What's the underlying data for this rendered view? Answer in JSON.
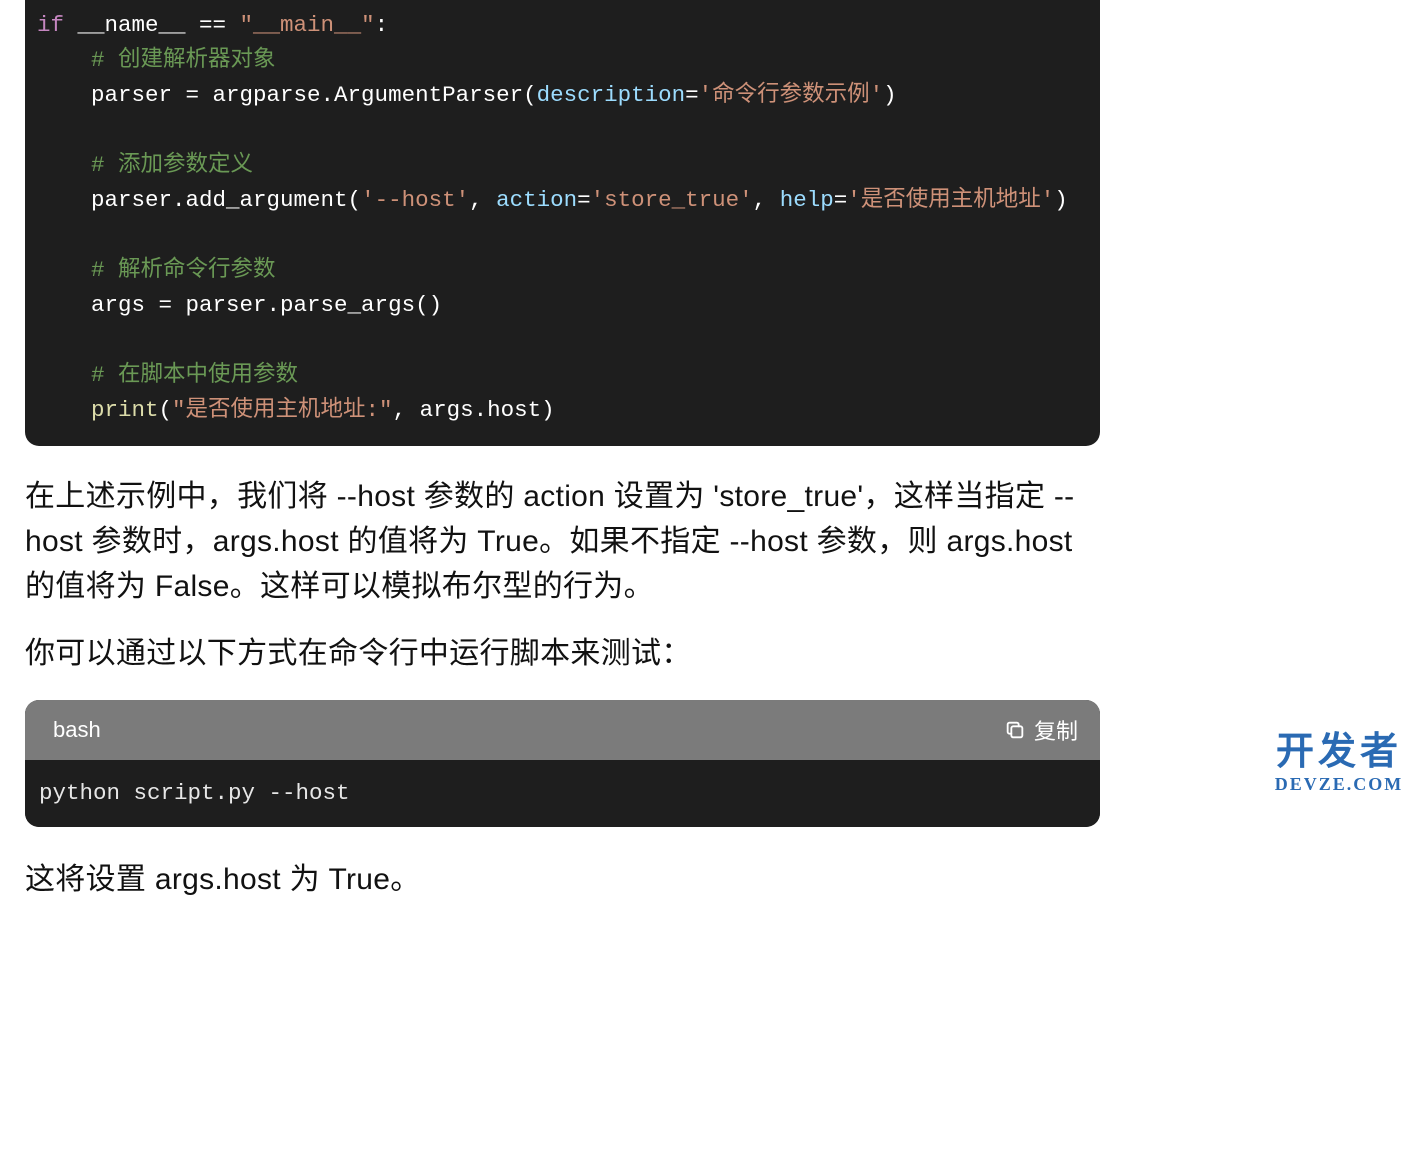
{
  "code1": {
    "segments": [
      [
        {
          "t": "if",
          "c": "t-kw"
        },
        {
          "t": " __name__ == ",
          "c": "t-white"
        },
        {
          "t": "\"__main__\"",
          "c": "t-orange"
        },
        {
          "t": ":",
          "c": "t-white"
        }
      ],
      [
        {
          "t": "    # 创建解析器对象",
          "c": "t-cmt"
        }
      ],
      [
        {
          "t": "    parser = argparse.ArgumentParser(",
          "c": "t-white"
        },
        {
          "t": "description",
          "c": "t-arg"
        },
        {
          "t": "=",
          "c": "t-white"
        },
        {
          "t": "'命令行参数示例'",
          "c": "t-orange"
        },
        {
          "t": ")",
          "c": "t-white"
        }
      ],
      [],
      [
        {
          "t": "    # 添加参数定义",
          "c": "t-cmt"
        }
      ],
      [
        {
          "t": "    parser.add_argument(",
          "c": "t-white"
        },
        {
          "t": "'--host'",
          "c": "t-orange"
        },
        {
          "t": ", ",
          "c": "t-white"
        },
        {
          "t": "action",
          "c": "t-arg"
        },
        {
          "t": "=",
          "c": "t-white"
        },
        {
          "t": "'store_true'",
          "c": "t-orange"
        },
        {
          "t": ", ",
          "c": "t-white"
        },
        {
          "t": "help",
          "c": "t-arg"
        },
        {
          "t": "=",
          "c": "t-white"
        },
        {
          "t": "'是否使用主机地址'",
          "c": "t-orange"
        },
        {
          "t": ")",
          "c": "t-white"
        }
      ],
      [],
      [
        {
          "t": "    # 解析命令行参数",
          "c": "t-cmt"
        }
      ],
      [
        {
          "t": "    args = parser.parse_args()",
          "c": "t-white"
        }
      ],
      [],
      [
        {
          "t": "    # 在脚本中使用参数",
          "c": "t-cmt"
        }
      ],
      [
        {
          "t": "    ",
          "c": ""
        },
        {
          "t": "print",
          "c": "t-func"
        },
        {
          "t": "(",
          "c": "t-white"
        },
        {
          "t": "\"是否使用主机地址:\"",
          "c": "t-orange"
        },
        {
          "t": ", args.host)",
          "c": "t-white"
        }
      ]
    ]
  },
  "paragraph1": "在上述示例中，我们将 --host 参数的 action 设置为 'store_true'，这样当指定 --host 参数时，args.host 的值将为 True。如果不指定 --host 参数，则 args.host 的值将为 False。这样可以模拟布尔型的行为。",
  "paragraph2": "你可以通过以下方式在命令行中运行脚本来测试：",
  "bash": {
    "lang_label": "bash",
    "copy_label": "复制",
    "code": "python script.py --host"
  },
  "paragraph3": "这将设置 args.host 为 True。",
  "watermark": {
    "line1": "开发者",
    "line2": "DEVZE.COM"
  }
}
